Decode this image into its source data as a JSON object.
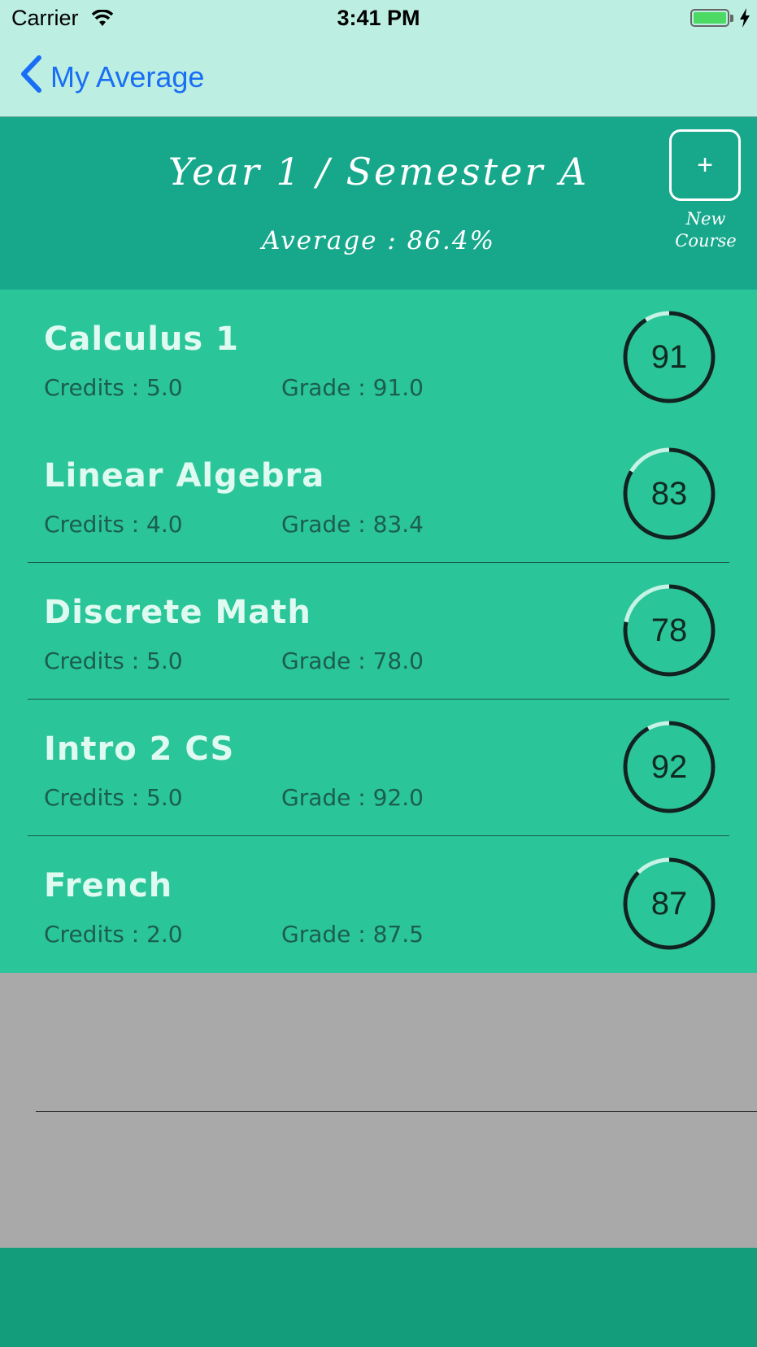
{
  "status_bar": {
    "carrier": "Carrier",
    "time": "3:41 PM",
    "battery_color": "#4cd964"
  },
  "nav": {
    "back_label": "My Average"
  },
  "header": {
    "title": "Year 1 / Semester A",
    "average": "Average : 86.4%",
    "new_course_icon": "+",
    "new_course_label": "New\nCourse"
  },
  "courses": [
    {
      "name": "Calculus 1",
      "credits": "Credits : 5.0",
      "grade": "Grade : 91.0",
      "ring_value": "91",
      "progress": 0.91
    },
    {
      "name": "Linear Algebra",
      "credits": "Credits : 4.0",
      "grade": "Grade : 83.4",
      "ring_value": "83",
      "progress": 0.834
    },
    {
      "name": "Discrete Math",
      "credits": "Credits : 5.0",
      "grade": "Grade : 78.0",
      "ring_value": "78",
      "progress": 0.78
    },
    {
      "name": "Intro 2 CS",
      "credits": "Credits : 5.0",
      "grade": "Grade : 92.0",
      "ring_value": "92",
      "progress": 0.92
    },
    {
      "name": "French",
      "credits": "Credits : 2.0",
      "grade": "Grade : 87.5",
      "ring_value": "87",
      "progress": 0.875
    }
  ],
  "colors": {
    "ring_progress": "#0f2320",
    "ring_track": "#c6f3e5",
    "row_background": "#2ac598",
    "header_background": "#17a88c"
  }
}
